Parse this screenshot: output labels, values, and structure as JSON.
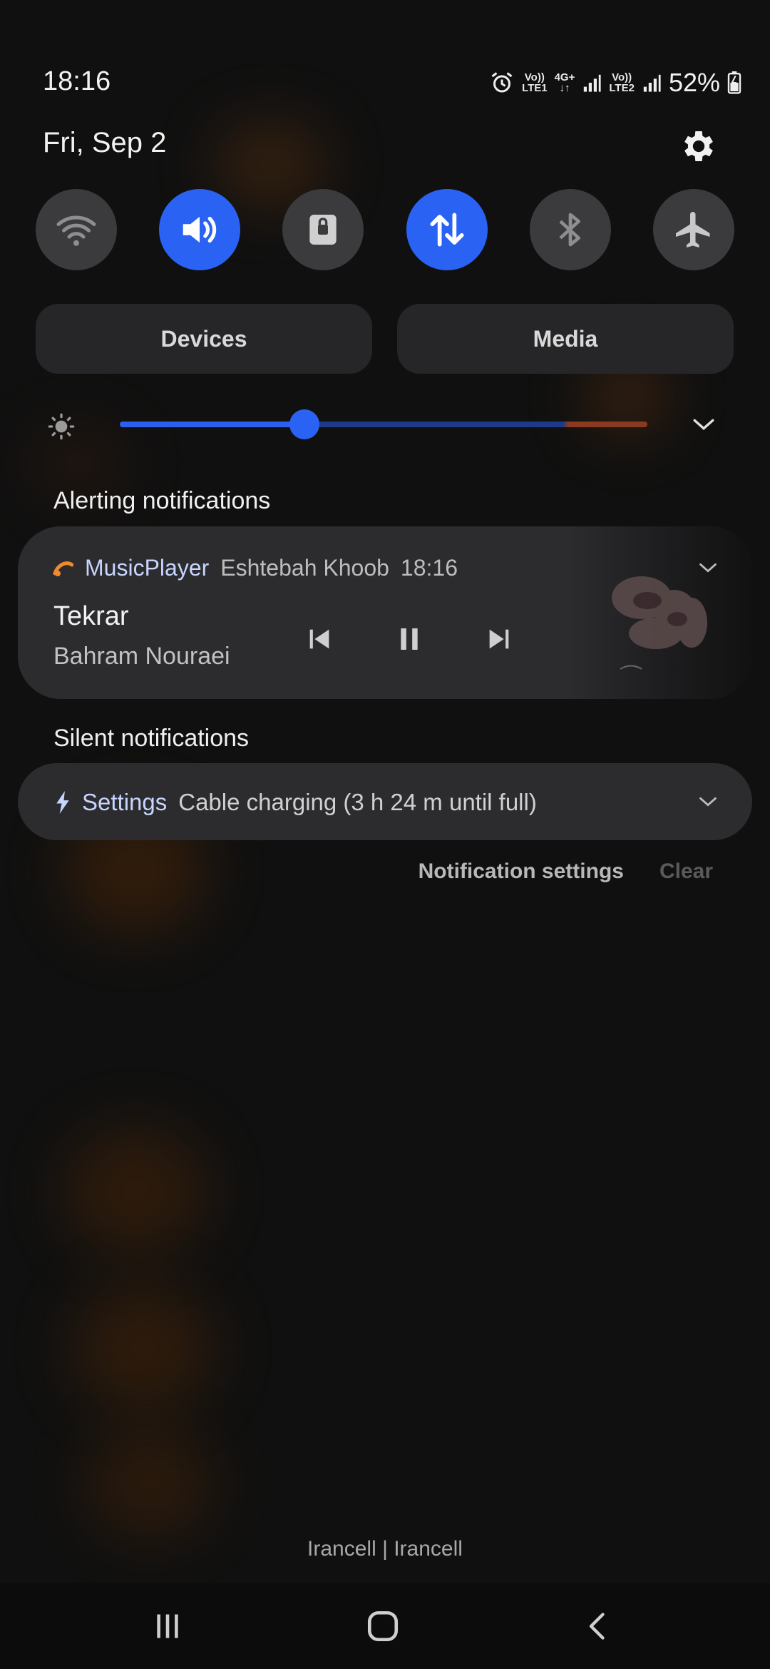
{
  "status_bar": {
    "time": "18:16",
    "sim1_top": "Vo))",
    "sim1_bottom": "LTE1",
    "network_top": "4G+",
    "sim2_top": "Vo))",
    "sim2_bottom": "LTE2",
    "battery": "52%"
  },
  "header": {
    "date": "Fri, Sep 2"
  },
  "quick_settings": {
    "tiles": [
      {
        "name": "wifi",
        "active": false
      },
      {
        "name": "sound",
        "active": true
      },
      {
        "name": "screen-lock",
        "active": false
      },
      {
        "name": "mobile-data",
        "active": true
      },
      {
        "name": "bluetooth",
        "active": false
      },
      {
        "name": "airplane-mode",
        "active": false
      }
    ],
    "devices_label": "Devices",
    "media_label": "Media",
    "brightness_level": 0.35
  },
  "alerting": {
    "section_label": "Alerting notifications",
    "music": {
      "app": "MusicPlayer",
      "subtitle": "Eshtebah Khoob",
      "time": "18:16",
      "title": "Tekrar",
      "artist": "Bahram Nouraei"
    }
  },
  "silent": {
    "section_label": "Silent notifications",
    "settings": {
      "app": "Settings",
      "message": "Cable charging (3 h 24 m until full)"
    }
  },
  "actions": {
    "notification_settings": "Notification settings",
    "clear": "Clear"
  },
  "carrier": "Irancell | Irancell",
  "colors": {
    "accent": "#2a63f3",
    "tile_off": "#3b3b3d",
    "card": "#2c2c2e",
    "music_icon": "#f08a2c"
  }
}
